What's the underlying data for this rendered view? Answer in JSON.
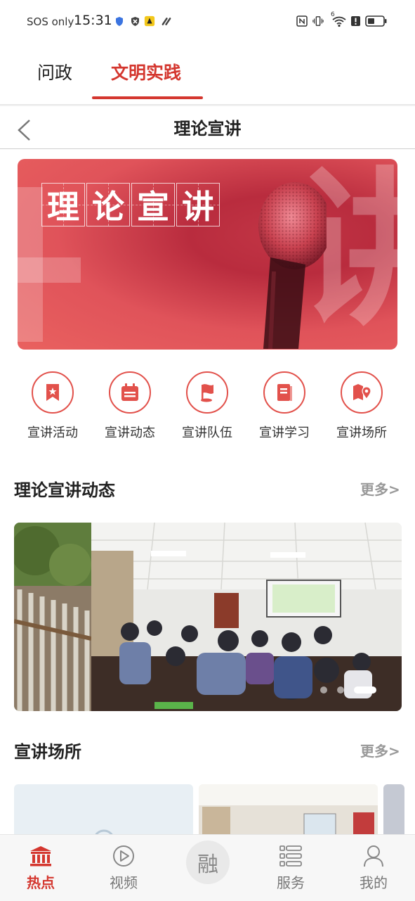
{
  "status_bar": {
    "carrier": "SOS only",
    "time": "15:31",
    "icons": [
      "shield-icon",
      "block-icon",
      "app-notification-icon",
      "link-icon",
      "nfc-icon",
      "vibrate-icon",
      "wifi-icon",
      "alert-icon",
      "battery-icon"
    ],
    "wifi_badge": "6"
  },
  "top_tabs": [
    {
      "label": "问政",
      "active": false
    },
    {
      "label": "文明实践",
      "active": true
    }
  ],
  "header": {
    "title": "理论宣讲",
    "back_icon": "chevron-left-icon"
  },
  "banner": {
    "title_chars": [
      "理",
      "论",
      "宣",
      "讲"
    ],
    "bg_chars": [
      "讲"
    ]
  },
  "categories": [
    {
      "label": "宣讲活动",
      "icon": "bookmark-star-icon"
    },
    {
      "label": "宣讲动态",
      "icon": "calendar-icon"
    },
    {
      "label": "宣讲队伍",
      "icon": "flag-icon"
    },
    {
      "label": "宣讲学习",
      "icon": "book-icon"
    },
    {
      "label": "宣讲场所",
      "icon": "map-pin-icon"
    }
  ],
  "sections": {
    "news": {
      "title": "理论宣讲动态",
      "more": "更多>"
    },
    "venues": {
      "title": "宣讲场所",
      "more": "更多>"
    }
  },
  "carousel": {
    "slide_count": 3,
    "active_index": 2
  },
  "bottom_nav": {
    "items": [
      {
        "label": "热点",
        "icon": "building-icon",
        "active": true
      },
      {
        "label": "视频",
        "icon": "play-circle-icon",
        "active": false
      },
      {
        "label": "服务",
        "icon": "list-icon",
        "active": false
      },
      {
        "label": "我的",
        "icon": "user-icon",
        "active": false
      }
    ],
    "center": {
      "label": "融"
    }
  },
  "colors": {
    "accent": "#d4372f",
    "banner": "#e0535a",
    "muted": "#999999"
  }
}
